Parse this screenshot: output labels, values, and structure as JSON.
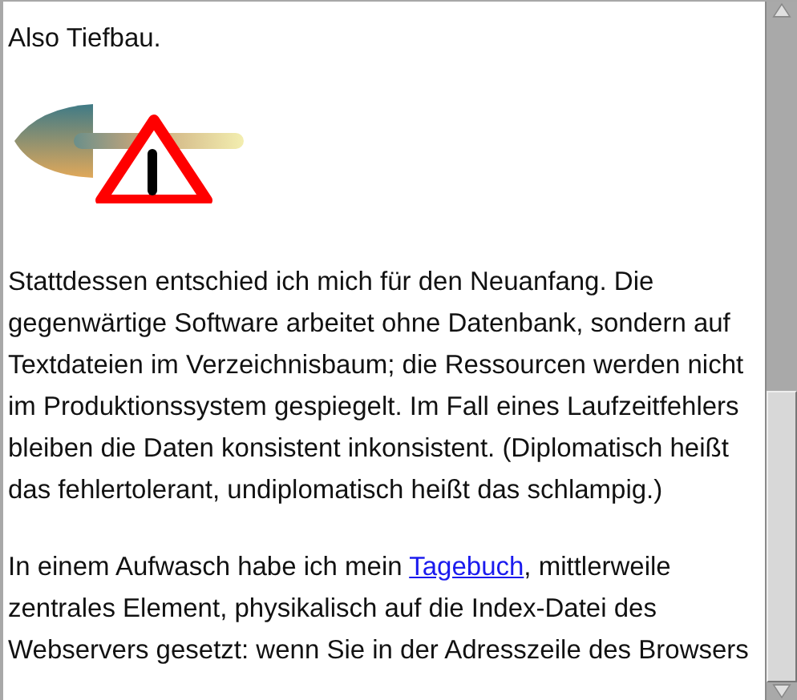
{
  "heading_text": "Also Tiefbau.",
  "paragraphs": [
    {
      "parts": [
        {
          "kind": "text",
          "text": "Stattdessen entschied ich mich für den Neuanfang. Die gegenwärtige Software arbeitet ohne Datenbank, sondern auf Textdateien im Verzeichnisbaum; die Ressourcen werden nicht im Produktionssystem gespiegelt. Im Fall eines Laufzeitfehlers bleiben die Daten konsistent inkonsistent. (Diplomatisch heißt das fehlertolerant, undiplomatisch heißt das schlampig.)"
        }
      ]
    },
    {
      "parts": [
        {
          "kind": "text",
          "text": "In einem Aufwasch habe ich mein "
        },
        {
          "kind": "link",
          "text": "Tagebuch"
        },
        {
          "kind": "text",
          "text": ", mittlerweile zentrales Element, physikalisch auf die Index-Datei des Webservers gesetzt: wenn Sie in der Adresszeile des Browsers"
        }
      ]
    }
  ]
}
